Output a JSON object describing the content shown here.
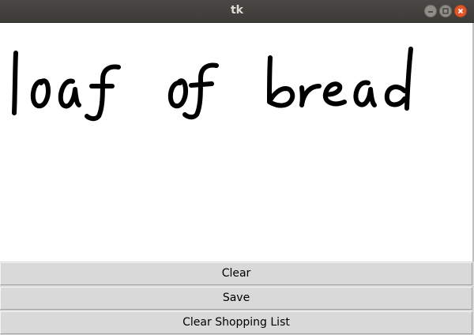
{
  "window": {
    "title": "tk"
  },
  "canvas": {
    "handwritten_text": "loaf of bread",
    "ink_color": "#000000"
  },
  "buttons": {
    "clear": "Clear",
    "save": "Save",
    "clear_list": "Clear Shopping List"
  },
  "colors": {
    "titlebar": "#3c3b37",
    "close_button": "#e2572c",
    "button_bg": "#d9d9d9",
    "canvas_bg": "#ffffff"
  }
}
